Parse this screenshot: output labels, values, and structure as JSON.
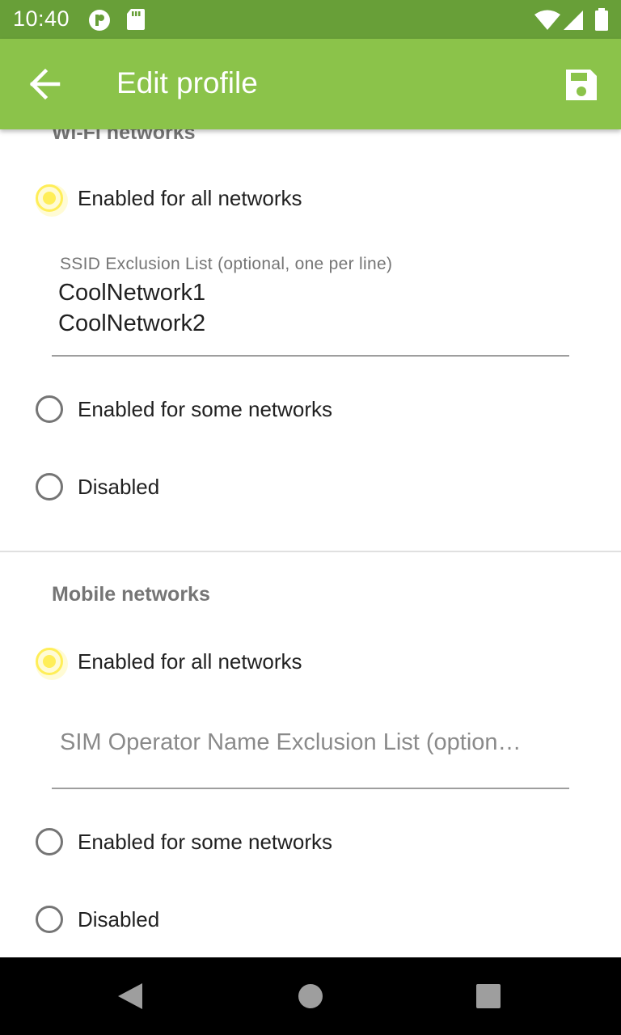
{
  "status_bar": {
    "time": "10:40",
    "icons": [
      "app-notification-icon",
      "sd-card-icon",
      "wifi-icon",
      "cellular-signal-icon",
      "battery-icon"
    ]
  },
  "app_bar": {
    "title": "Edit profile",
    "back_icon": "arrow-back-icon",
    "save_icon": "save-icon",
    "background": "#8bc34a",
    "status_bar_color": "#689f38"
  },
  "wifi_section": {
    "header": "Wi-Fi networks",
    "options": [
      {
        "label": "Enabled for all networks",
        "selected": true
      },
      {
        "label": "Enabled for some networks",
        "selected": false
      },
      {
        "label": "Disabled",
        "selected": false
      }
    ],
    "exclusion_field": {
      "label": "SSID Exclusion List (optional, one per line)",
      "value": "CoolNetwork1\nCoolNetwork2"
    }
  },
  "mobile_section": {
    "header": "Mobile networks",
    "options": [
      {
        "label": "Enabled for all networks",
        "selected": true
      },
      {
        "label": "Enabled for some networks",
        "selected": false
      },
      {
        "label": "Disabled",
        "selected": false
      }
    ],
    "exclusion_field": {
      "placeholder": "SIM Operator Name Exclusion List (option…",
      "value": ""
    }
  },
  "accent_color": "#ffee58",
  "nav_bar": {
    "icons": [
      "back-triangle-icon",
      "home-circle-icon",
      "recents-square-icon"
    ]
  }
}
